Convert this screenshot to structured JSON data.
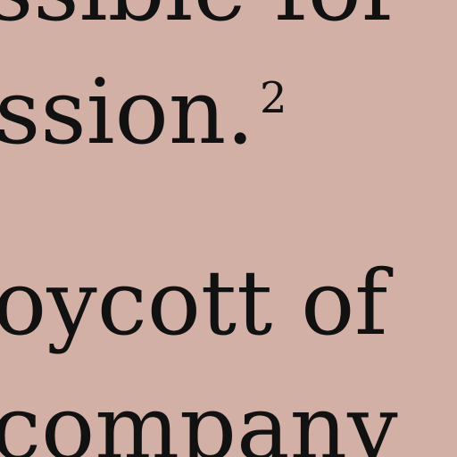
{
  "document": {
    "lines": [
      "ssible for",
      "ssion.",
      "oycott of",
      "company"
    ],
    "footnote_marker": "2"
  },
  "colors": {
    "background": "#d3b0a6",
    "text": "#111111"
  }
}
